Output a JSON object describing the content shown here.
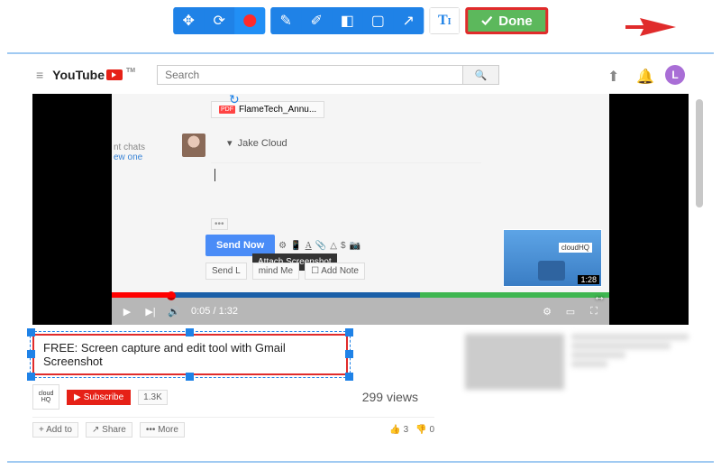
{
  "toolbar": {
    "done_label": "Done"
  },
  "youtube": {
    "brand": "YouTube",
    "search_placeholder": "Search",
    "avatar_initial": "L"
  },
  "gmail": {
    "attachment": "FlameTech_Annu...",
    "chats_line1": "nt chats",
    "chats_line2": "ew one",
    "to_name": "Jake Cloud",
    "send_label": "Send Now",
    "tooltip": "Attach Screenshot",
    "sendl": "Send L",
    "mind": "mind Me",
    "addnote": "Add Note",
    "thumb_label": "cloudHQ",
    "thumb_duration": "1:28"
  },
  "player": {
    "time_current": "0:05",
    "time_total": "1:32"
  },
  "video": {
    "title": "FREE: Screen capture and edit tool with Gmail Screenshot",
    "channel": "cloud HQ",
    "subscribe": "Subscribe",
    "sub_count": "1.3K",
    "views": "299 views",
    "add_to": "Add to",
    "share": "Share",
    "more": "More",
    "likes": "3",
    "dislikes": "0"
  }
}
